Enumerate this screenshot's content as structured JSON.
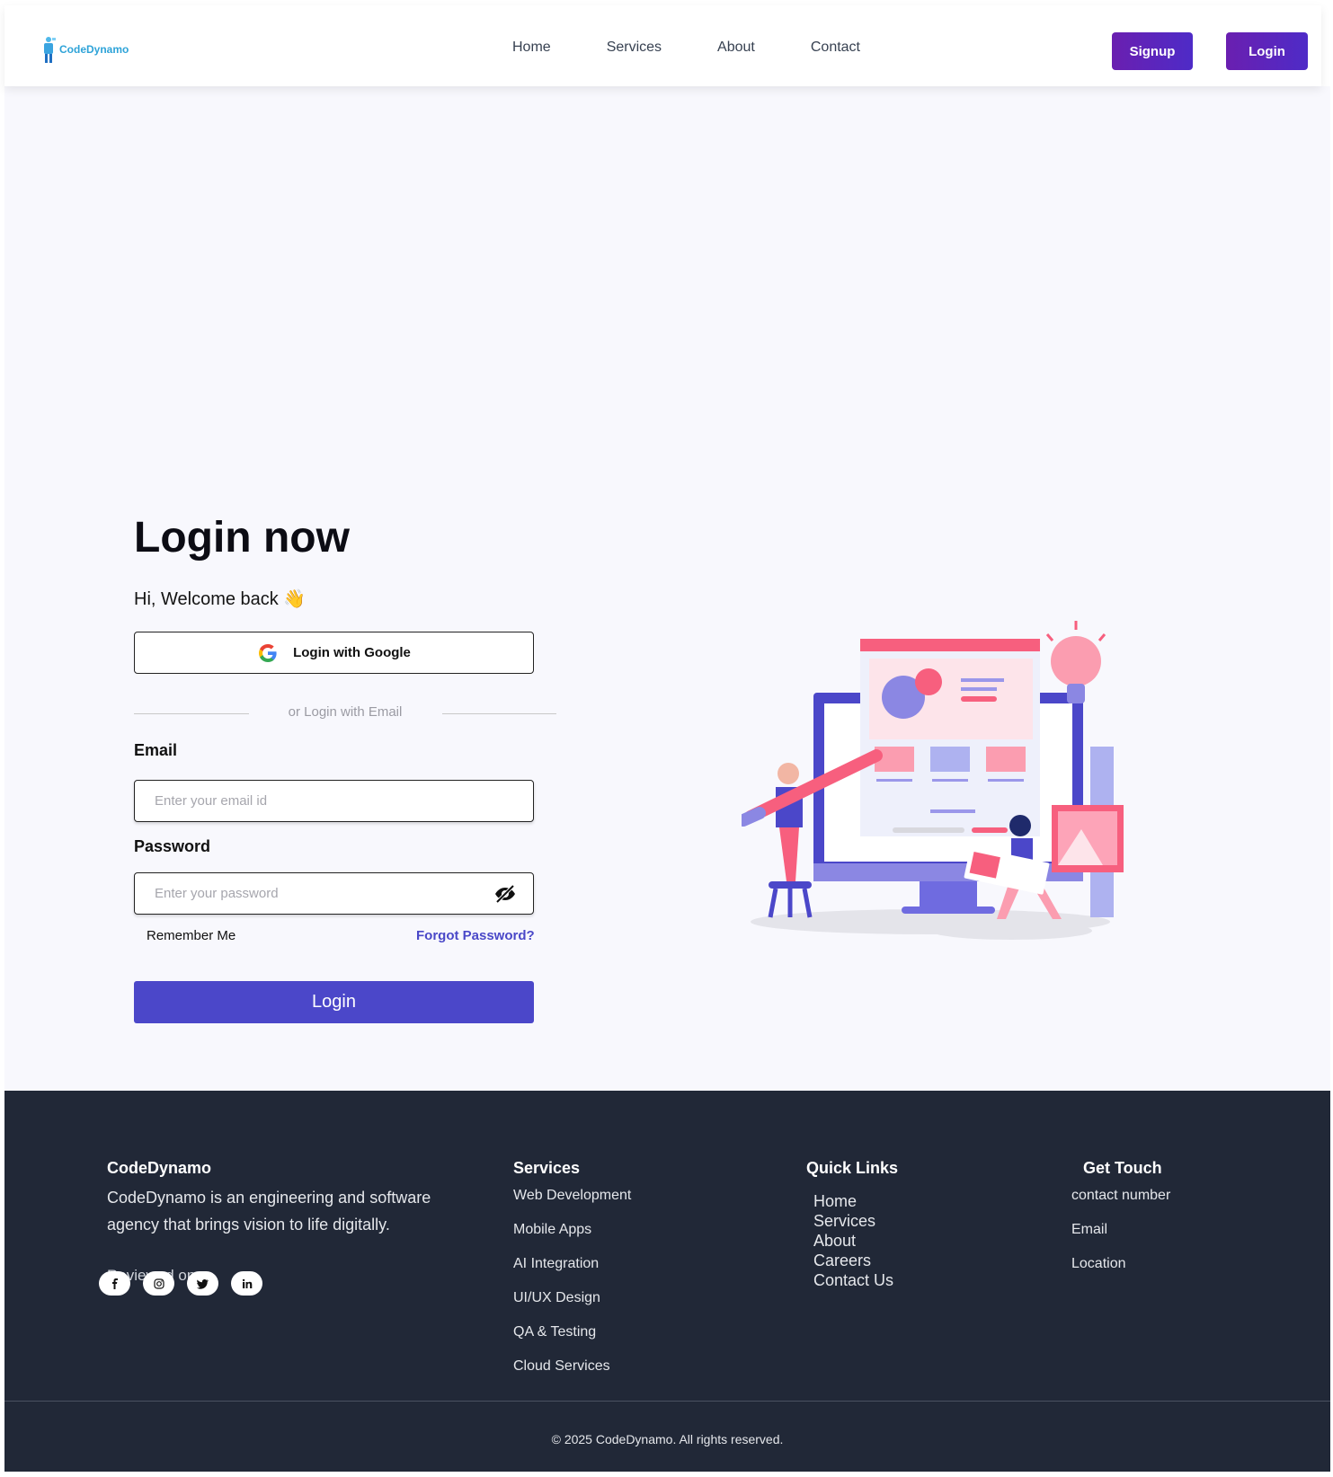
{
  "header": {
    "logo_text": "CodeDynamo",
    "nav": [
      "Home",
      "Services",
      "About",
      "Contact"
    ],
    "signup_label": "Signup",
    "login_label": "Login"
  },
  "login": {
    "title": "Login now",
    "welcome": "Hi, Welcome back",
    "wave_emoji": "👋",
    "google_label": "Login with Google",
    "divider_text": "or Login with Email",
    "email_label": "Email",
    "email_placeholder": "Enter your email id",
    "password_label": "Password",
    "password_placeholder": "Enter your password",
    "remember_label": "Remember Me",
    "forgot_label": "Forgot Password?",
    "submit_label": "Login"
  },
  "footer": {
    "brand": "CodeDynamo",
    "description": "CodeDynamo is an engineering and software agency that brings vision to life digitally.",
    "reviewed_on": "Reviewed on",
    "socials": [
      "facebook-icon",
      "instagram-icon",
      "twitter-icon",
      "linkedin-icon"
    ],
    "services_heading": "Services",
    "services": [
      "Web Development",
      "Mobile Apps",
      "AI Integration",
      "UI/UX Design",
      "QA & Testing",
      "Cloud Services"
    ],
    "quick_heading": "Quick Links",
    "quick_links": [
      "Home",
      "Services",
      "About",
      "Careers",
      "Contact Us"
    ],
    "touch_heading": "Get Touch",
    "touch": [
      "contact number",
      "Email",
      "Location"
    ],
    "copyright": "© 2025 CodeDynamo. All rights reserved."
  },
  "colors": {
    "brand_purple": "#4b47c9",
    "header_button": "#5b24bd",
    "footer_bg": "#212837",
    "main_bg": "#f8f8fd",
    "logo_blue": "#2ea3d8",
    "accent_pink": "#f75f7e"
  }
}
